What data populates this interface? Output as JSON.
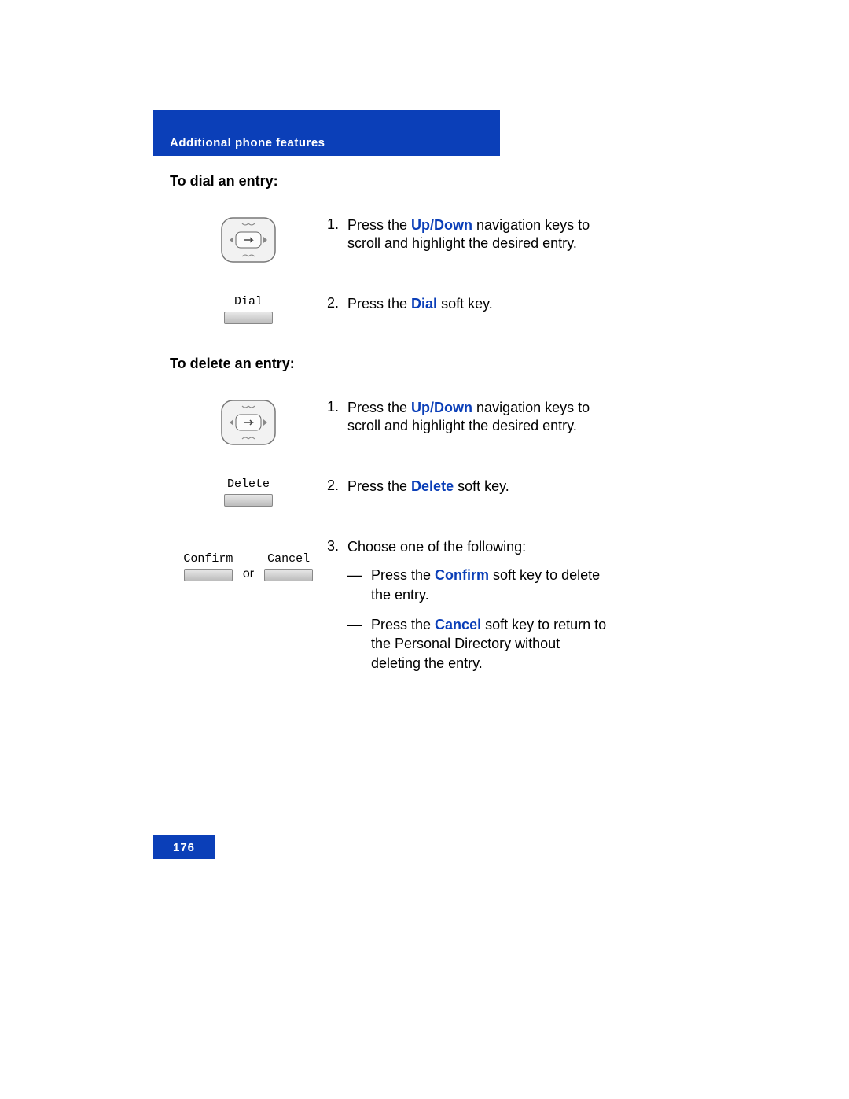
{
  "header": {
    "title": "Additional phone features"
  },
  "sections": {
    "dial": {
      "title": "To dial an entry:",
      "steps": [
        {
          "num": "1.",
          "pre": "Press the ",
          "term": "Up/Down",
          "post": " navigation keys to scroll and highlight the desired entry."
        },
        {
          "num": "2.",
          "pre": "Press the ",
          "term": "Dial",
          "post": " soft key."
        }
      ],
      "softkey": {
        "label": "Dial"
      }
    },
    "delete": {
      "title": "To delete an entry:",
      "steps": [
        {
          "num": "1.",
          "pre": "Press the ",
          "term": "Up/Down",
          "post": " navigation keys to scroll and highlight the desired entry."
        },
        {
          "num": "2.",
          "pre": "Press the ",
          "term": "Delete",
          "post": " soft key."
        },
        {
          "num": "3.",
          "pre": "Choose one of the following:",
          "term": "",
          "post": ""
        }
      ],
      "softkey_delete": {
        "label": "Delete"
      },
      "softkey_confirm": {
        "label": "Confirm"
      },
      "softkey_cancel": {
        "label": "Cancel"
      },
      "or": "or",
      "subs": [
        {
          "dash": "—",
          "pre": "Press the ",
          "term": "Confirm",
          "post": " soft key to delete the entry."
        },
        {
          "dash": "—",
          "pre": "Press the ",
          "term": "Cancel",
          "post": " soft key to return to the Personal Directory without deleting the entry."
        }
      ]
    }
  },
  "footer": {
    "page": "176"
  }
}
